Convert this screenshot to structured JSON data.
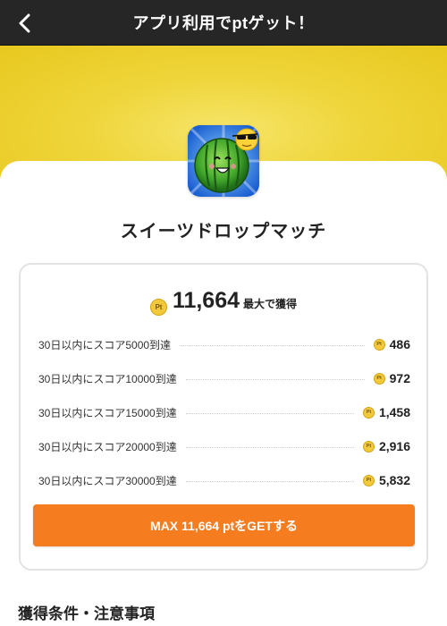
{
  "header": {
    "title": "アプリ利用でptゲット！",
    "back_icon": "chevron-left-icon"
  },
  "colors": {
    "header_bg": "#262626",
    "hero_bg": "#efd53a",
    "accent": "#f57c1f",
    "coin": "#f3c93c"
  },
  "app": {
    "name": "スイーツドロップマッチ",
    "icon": "watermelon-app-icon"
  },
  "reward": {
    "coin_label": "Pt",
    "total": "11,664",
    "total_suffix": "最大で獲得",
    "tasks": [
      {
        "label": "30日以内にスコア5000到達",
        "points": "486"
      },
      {
        "label": "30日以内にスコア10000到達",
        "points": "972"
      },
      {
        "label": "30日以内にスコア15000到達",
        "points": "1,458"
      },
      {
        "label": "30日以内にスコア20000到達",
        "points": "2,916"
      },
      {
        "label": "30日以内にスコア30000到達",
        "points": "5,832"
      }
    ],
    "button_label": "MAX 11,664 ptをGETする"
  },
  "section": {
    "title": "獲得条件・注意事項"
  }
}
